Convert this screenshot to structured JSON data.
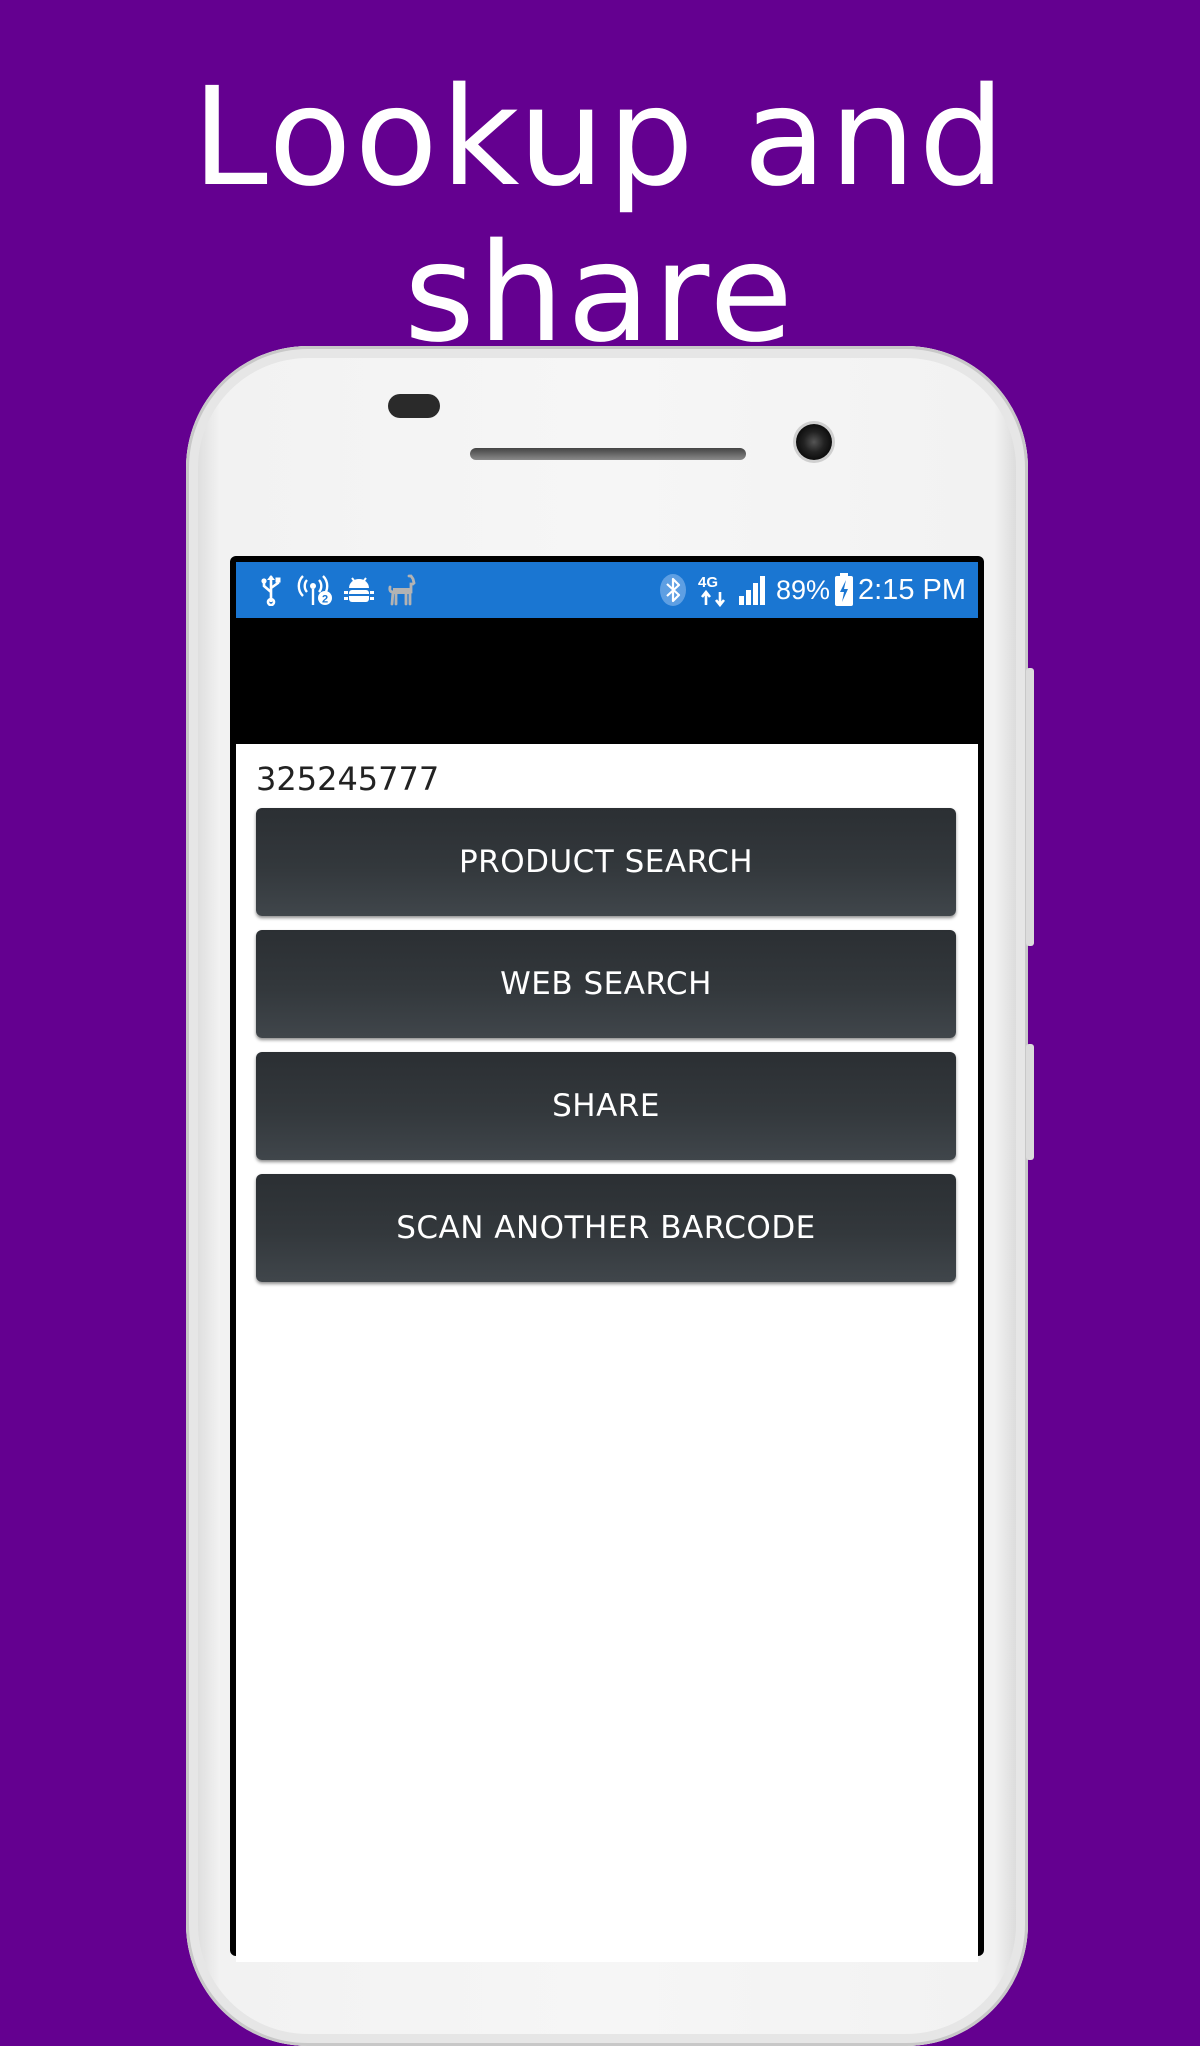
{
  "headline": "Lookup and share",
  "status_bar": {
    "network": "4G",
    "battery_percent": "89%",
    "time": "2:15 PM",
    "icons": [
      "usb-icon",
      "hotspot-icon",
      "android-debug-icon",
      "llama-icon",
      "bluetooth-icon",
      "network-4g-icon",
      "signal-icon",
      "battery-charging-icon"
    ]
  },
  "content": {
    "barcode_value": "325245777",
    "buttons": {
      "product_search": "PRODUCT SEARCH",
      "web_search": "WEB SEARCH",
      "share": "SHARE",
      "scan_another": "SCAN ANOTHER BARCODE"
    }
  },
  "colors": {
    "background": "#640090",
    "status_bar": "#1a76d2",
    "action_bar": "#000000",
    "button": "#33383c"
  }
}
